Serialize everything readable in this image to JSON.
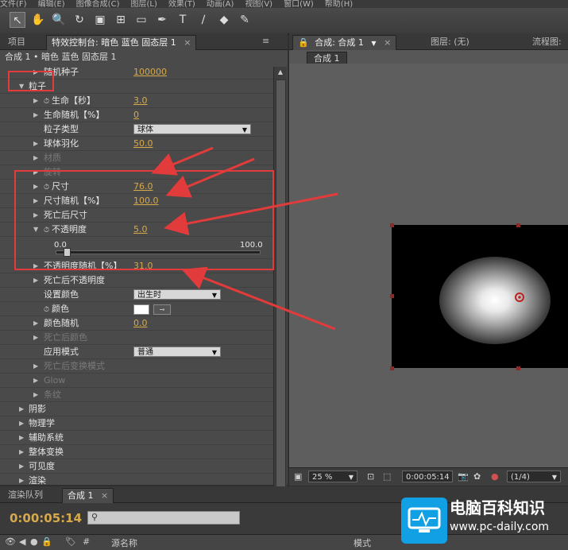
{
  "menu": [
    "文件(F)",
    "编辑(E)",
    "图像合成(C)",
    "图层(L)",
    "效果(T)",
    "动画(A)",
    "视图(V)",
    "窗口(W)",
    "帮助(H)"
  ],
  "tools": [
    "selection-tool",
    "hand-tool",
    "zoom-tool",
    "rotate-tool",
    "camera-tool",
    "pan-behind-tool",
    "rectangle-tool",
    "pen-tool",
    "text-tool",
    "brush-tool",
    "eraser-tool",
    "puppet-tool"
  ],
  "tool_glyphs": [
    "↖",
    "✋",
    "🔍",
    "↻",
    "▣",
    "⊞",
    "▭",
    "✒",
    "T",
    "∕",
    "◆",
    "✎"
  ],
  "left_panel": {
    "tab_project": "项目",
    "tab_effect": "特效控制台: 暗色 蓝色 固态层 1",
    "sub_header": "合成 1 • 暗色 蓝色 固态层 1"
  },
  "rows": [
    {
      "label": "随机种子",
      "value": "100000",
      "partial": true
    },
    {
      "label": "粒子",
      "twirl": "open",
      "boxed": true
    },
    {
      "label": "生命【秒】",
      "value": "3.0",
      "stopwatch": true
    },
    {
      "label": "生命随机【%】",
      "value": "0"
    },
    {
      "label": "粒子类型",
      "dropdown": "球体"
    },
    {
      "label": "球体羽化",
      "value": "50.0"
    },
    {
      "label": "材质",
      "disabled": true
    },
    {
      "label": "旋转",
      "disabled": true
    },
    {
      "label": "尺寸",
      "value": "76.0",
      "stopwatch": true
    },
    {
      "label": "尺寸随机【%】",
      "value": "100.0"
    },
    {
      "label": "死亡后尺寸"
    },
    {
      "label": "不透明度",
      "value": "5.0",
      "stopwatch": true,
      "twirl": "open"
    },
    {
      "slider": true,
      "min": "0.0",
      "max": "100.0",
      "level": 0.05
    },
    {
      "label": "不透明度随机【%】",
      "value": "31.0"
    },
    {
      "label": "死亡后不透明度"
    },
    {
      "label": "设置颜色",
      "dropdown": "出生时"
    },
    {
      "label": "颜色",
      "stopwatch": true,
      "swatch": "#ffffff"
    },
    {
      "label": "颜色随机",
      "value": "0.0"
    },
    {
      "label": "死亡后颜色",
      "disabled": true
    },
    {
      "label": "应用模式",
      "dropdown": "普通"
    },
    {
      "label": "死亡后变换模式",
      "disabled": true
    },
    {
      "label": "Glow",
      "disabled": true
    },
    {
      "label": "条纹",
      "disabled": true
    }
  ],
  "top_groups": [
    "阴影",
    "物理学",
    "辅助系统",
    "整体变换",
    "可见度",
    "渲染"
  ],
  "right_panel": {
    "tab_comp": "合成: 合成 1",
    "tab_layer": "图层: (无)",
    "tab_flow": "流程图:",
    "breadcrumb": "合成 1",
    "zoom": "25 %",
    "timecode": "0:00:05:14",
    "resolution": "(1/4)"
  },
  "timeline": {
    "tab_render": "渲染队列",
    "tab_comp": "合成 1",
    "timecode": "0:00:05:14",
    "col_source": "源名称",
    "col_mode": "模式"
  },
  "watermark": {
    "title": "电脑百科知识",
    "url": "www.pc-daily.com"
  },
  "colors": {
    "value_orange": "#d6a94a",
    "annotation_red": "#e23b3b",
    "watermark_blue": "#12a0e4"
  }
}
